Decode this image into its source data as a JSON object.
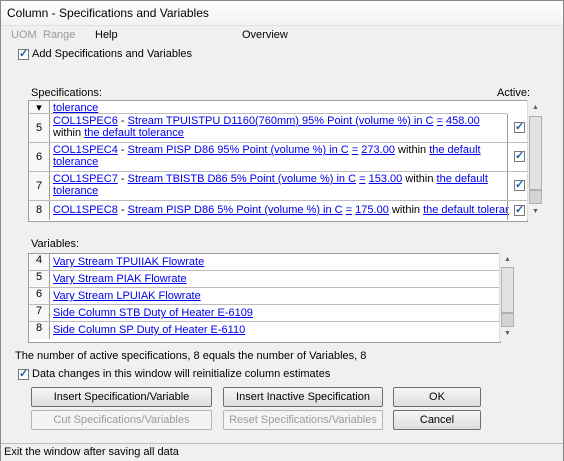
{
  "window": {
    "title": "Column - Specifications and Variables"
  },
  "menu": {
    "uom": "UOM",
    "range": "Range",
    "help": "Help",
    "overview": "Overview"
  },
  "add_specs": {
    "label": "Add Specifications and Variables",
    "checked": true
  },
  "specs": {
    "header": "Specifications:",
    "active_header": "Active:",
    "partial_row_text": "tolerance",
    "rows": [
      {
        "num": "5",
        "prefix": "COL1SPEC6",
        "sep": "-",
        "stream": "Stream TPUISTPU D1160(760mm) 95% Point (volume %) in C",
        "eq": "=",
        "value": "458.00",
        "within": "within",
        "tol": "the default tolerance",
        "active": true
      },
      {
        "num": "6",
        "prefix": "COL1SPEC4",
        "sep": "-",
        "stream": "Stream PISP D86 95% Point (volume %) in C",
        "eq": "=",
        "value": "273.00",
        "within": "within",
        "tol": "the default tolerance",
        "active": true
      },
      {
        "num": "7",
        "prefix": "COL1SPEC7",
        "sep": "-",
        "stream": "Stream TBISTB D86 5% Point (volume %) in C",
        "eq": "=",
        "value": "153.00",
        "within": "within",
        "tol": "the default tolerance",
        "active": true
      },
      {
        "num": "8",
        "prefix": "COL1SPEC8",
        "sep": "-",
        "stream": "Stream PISP D86 5% Point (volume %) in C",
        "eq": "=",
        "value": "175.00",
        "within": "within",
        "tol": "the default tolerance",
        "active": true
      }
    ]
  },
  "variables": {
    "header": "Variables:",
    "rows": [
      {
        "num": "4",
        "text": "Vary Stream TPUIIAK Flowrate"
      },
      {
        "num": "5",
        "text": "Vary Stream PIAK Flowrate"
      },
      {
        "num": "6",
        "text": "Vary Stream LPUIAK Flowrate"
      },
      {
        "num": "7",
        "text": "Side Column STB Duty of Heater E-6109"
      },
      {
        "num": "8",
        "text": "Side Column SP Duty of Heater E-6110"
      }
    ]
  },
  "info_text": "The number of active specifications, 8 equals the number of Variables, 8",
  "data_changes": {
    "label": "Data changes in this window will reinitialize column estimates",
    "checked": true
  },
  "buttons": {
    "insert_spec_var": "Insert Specification/Variable",
    "insert_inactive": "Insert Inactive Specification",
    "ok": "OK",
    "cut": "Cut Specifications/Variables",
    "reset": "Reset Specifications/Variables",
    "cancel": "Cancel"
  },
  "status": "Exit the window after saving all data"
}
